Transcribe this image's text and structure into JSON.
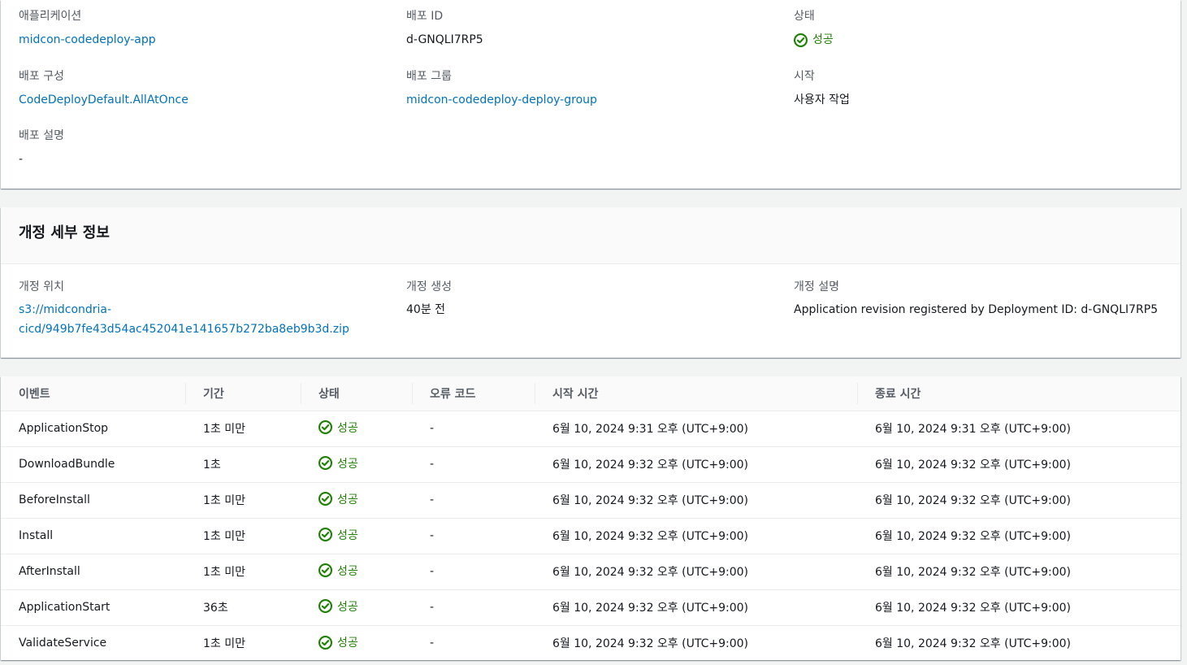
{
  "summary": {
    "application": {
      "label": "애플리케이션",
      "value": "midcon-codedeploy-app"
    },
    "deployment_id": {
      "label": "배포 ID",
      "value": "d-GNQLI7RP5"
    },
    "status": {
      "label": "상태",
      "value": "성공"
    },
    "deployment_config": {
      "label": "배포 구성",
      "value": "CodeDeployDefault.AllAtOnce"
    },
    "deployment_group": {
      "label": "배포 그룹",
      "value": "midcon-codedeploy-deploy-group"
    },
    "initiator": {
      "label": "시작",
      "value": "사용자 작업"
    },
    "description": {
      "label": "배포 설명",
      "value": "-"
    }
  },
  "revision": {
    "title": "개정 세부 정보",
    "location": {
      "label": "개정 위치",
      "value_line1": "s3://midcondria-",
      "value_line2": "cicd/949b7fe43d54ac452041e141657b272ba8eb9b3d.zip"
    },
    "created": {
      "label": "개정 생성",
      "value": "40분 전"
    },
    "description": {
      "label": "개정 설명",
      "value": "Application revision registered by Deployment ID: d-GNQLI7RP5"
    }
  },
  "events_table": {
    "columns": [
      "이벤트",
      "기간",
      "상태",
      "오류 코드",
      "시작 시간",
      "종료 시간"
    ],
    "rows": [
      {
        "event": "ApplicationStop",
        "duration": "1초 미만",
        "status": "성공",
        "error": "-",
        "start": "6월 10, 2024 9:31 오후 (UTC+9:00)",
        "end": "6월 10, 2024 9:31 오후 (UTC+9:00)"
      },
      {
        "event": "DownloadBundle",
        "duration": "1초",
        "status": "성공",
        "error": "-",
        "start": "6월 10, 2024 9:32 오후 (UTC+9:00)",
        "end": "6월 10, 2024 9:32 오후 (UTC+9:00)"
      },
      {
        "event": "BeforeInstall",
        "duration": "1초 미만",
        "status": "성공",
        "error": "-",
        "start": "6월 10, 2024 9:32 오후 (UTC+9:00)",
        "end": "6월 10, 2024 9:32 오후 (UTC+9:00)"
      },
      {
        "event": "Install",
        "duration": "1초 미만",
        "status": "성공",
        "error": "-",
        "start": "6월 10, 2024 9:32 오후 (UTC+9:00)",
        "end": "6월 10, 2024 9:32 오후 (UTC+9:00)"
      },
      {
        "event": "AfterInstall",
        "duration": "1초 미만",
        "status": "성공",
        "error": "-",
        "start": "6월 10, 2024 9:32 오후 (UTC+9:00)",
        "end": "6월 10, 2024 9:32 오후 (UTC+9:00)"
      },
      {
        "event": "ApplicationStart",
        "duration": "36초",
        "status": "성공",
        "error": "-",
        "start": "6월 10, 2024 9:32 오후 (UTC+9:00)",
        "end": "6월 10, 2024 9:32 오후 (UTC+9:00)"
      },
      {
        "event": "ValidateService",
        "duration": "1초 미만",
        "status": "성공",
        "error": "-",
        "start": "6월 10, 2024 9:32 오후 (UTC+9:00)",
        "end": "6월 10, 2024 9:32 오후 (UTC+9:00)"
      }
    ]
  },
  "colors": {
    "link": "#0073bb",
    "success": "#1d8102",
    "label": "#545b64",
    "text": "#16191f"
  },
  "icons": {
    "status_success": "check-circle-icon"
  }
}
